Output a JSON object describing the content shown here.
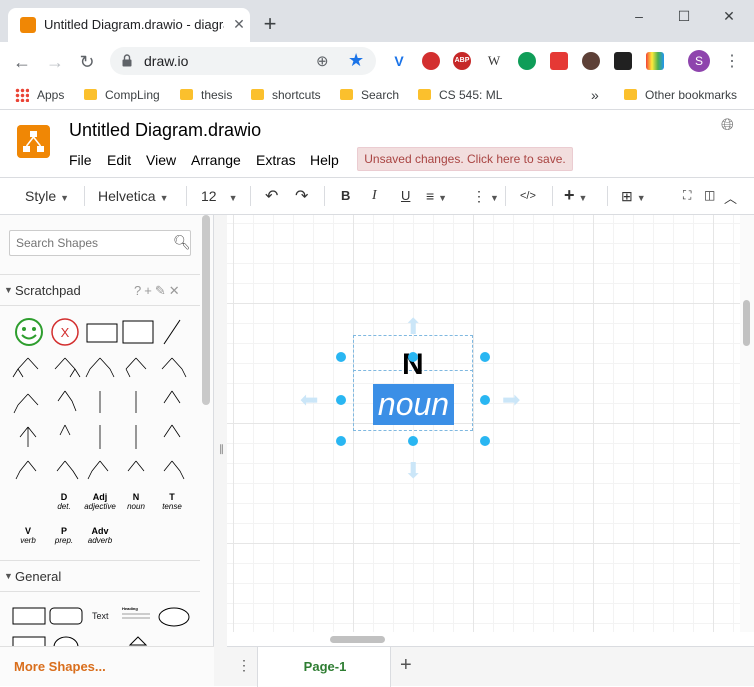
{
  "browser": {
    "tab_title": "Untitled Diagram.drawio - diagra",
    "url": "draw.io",
    "profile_initial": "S",
    "bookmarks": [
      "Apps",
      "CompLing",
      "thesis",
      "shortcuts",
      "Search",
      "CS 545: ML"
    ],
    "other_bookmarks": "Other bookmarks",
    "extensions": [
      "V",
      "",
      "ABP",
      "W",
      "",
      "",
      "",
      "",
      ""
    ]
  },
  "app": {
    "title": "Untitled Diagram.drawio",
    "menus": [
      "File",
      "Edit",
      "View",
      "Arrange",
      "Extras",
      "Help"
    ],
    "unsaved_notice": "Unsaved changes. Click here to save."
  },
  "format_toolbar": {
    "style_label": "Style",
    "font_label": "Helvetica",
    "size_label": "12",
    "bold": "B",
    "italic": "I",
    "underline": "U",
    "code": "</>"
  },
  "sidebar": {
    "search_placeholder": "Search Shapes",
    "scratchpad_label": "Scratchpad",
    "general_label": "General",
    "more_shapes": "More Shapes...",
    "lexical": [
      {
        "tag": "D",
        "word": "det."
      },
      {
        "tag": "Adj",
        "word": "adjective"
      },
      {
        "tag": "N",
        "word": "noun"
      },
      {
        "tag": "T",
        "word": "tense"
      },
      {
        "tag": "V",
        "word": "verb"
      },
      {
        "tag": "P",
        "word": "prep."
      },
      {
        "tag": "Adv",
        "word": "adverb"
      }
    ],
    "general_text": "Text",
    "general_heading": "Heading"
  },
  "canvas": {
    "node_label": "N",
    "word_label": "noun"
  },
  "pages": {
    "current": "Page-1"
  },
  "colors": {
    "drawio_orange": "#f08705",
    "selection_blue": "#29b6f2",
    "unsaved_bg": "#f2dede",
    "page_tab_green": "#2e7d32"
  }
}
